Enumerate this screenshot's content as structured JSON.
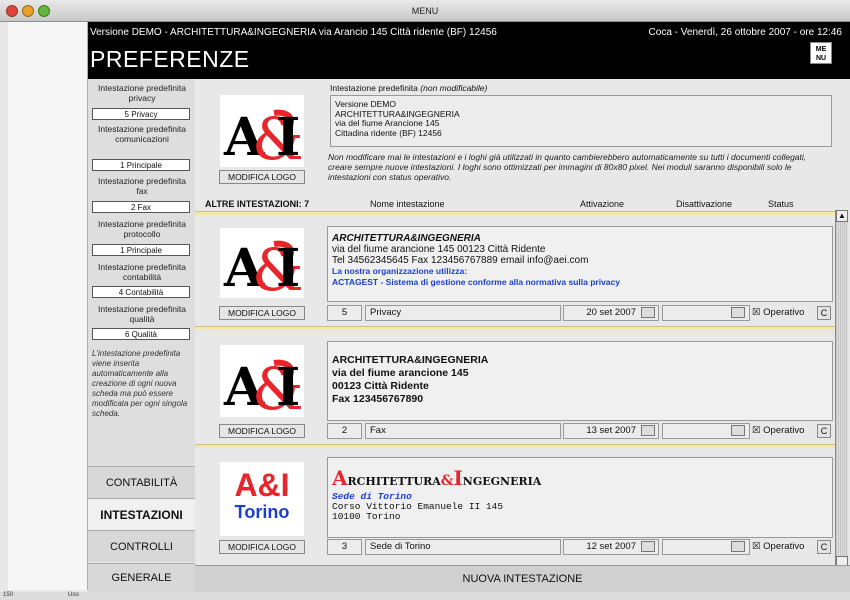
{
  "window": {
    "title": "MENU"
  },
  "header": {
    "demo_line": "Versione DEMO - ARCHITETTURA&INGEGNERIA via Arancio 145 Città ridente (BF) 12456",
    "date_line": "Coca - Venerdì, 26 ottobre 2007 - ore 12:46",
    "page_title": "PREFERENZE",
    "menu_button": "ME NU"
  },
  "prefs": [
    {
      "label": "Intestazione predefinita privacy",
      "value": "5 Privacy"
    },
    {
      "label": "Intestazione predefinita comunicazioni",
      "value": "1 Principale"
    },
    {
      "label": "Intestazione predefinita fax",
      "value": "2 Fax"
    },
    {
      "label": "Intestazione predefinita protocollo",
      "value": "1 Principale"
    },
    {
      "label": "Intestazione predefinita contabilità",
      "value": "4 Contabilità"
    },
    {
      "label": "Intestazione predefinita qualità",
      "value": "6 Qualità"
    }
  ],
  "pref_note": "L'intestazione predefinita viene inserita automaticamente alla creazione di ogni nuova scheda ma può essere modificata per ogni singola scheda.",
  "nav": {
    "contabilita": "CONTABILITÀ",
    "intestazioni": "INTESTAZIONI",
    "controlli": "CONTROLLI",
    "generale": "GENERALE"
  },
  "default_header": {
    "caption": "Intestazione predefinita",
    "caption_note": "(non modificabile)",
    "lines": [
      "Versione DEMO",
      "ARCHITETTURA&INGEGNERIA",
      "via del fiume Arancione 145",
      "Cittadina ridente (BF) 12456"
    ],
    "note": "Non modificare mai le intestazioni e i loghi già utilizzati in quanto cambierebbero automaticamente su tutti i documenti collegati, creare sempre nuove intestazioni. I loghi sono ottimizzati per immagini di 80x80 pixel. Nei moduli saranno disponibili solo le intestazioni con status operativo.",
    "modify_logo": "MODIFICA LOGO",
    "logo_text": "A&I"
  },
  "list": {
    "title": "ALTRE INTESTAZIONI: 7",
    "col_name": "Nome intestazione",
    "col_activation": "Attivazione",
    "col_deactivation": "Disattivazione",
    "col_status": "Status"
  },
  "rows": [
    {
      "modify_logo": "MODIFICA LOGO",
      "logo_text": "A&I",
      "l1": "ARCHITETTURA&INGEGNERIA",
      "l2": "via del fiume arancione 145 00123 Città Ridente",
      "l3": "Tel 34562345645 Fax 123456767889 email info@aei.com",
      "l4": "La nostra organizzazione utilizza:",
      "l5": "ACTAGEST - Sistema di gestione  conforme alla normativa sulla privacy",
      "num": "5",
      "name": "Privacy",
      "activation": "20 set 2007",
      "deactivation": "",
      "status": "Operativo",
      "c": "C"
    },
    {
      "modify_logo": "MODIFICA LOGO",
      "logo_text": "A&I",
      "l1": "ARCHITETTURA&INGEGNERIA",
      "l2": "via del fiume arancione 145",
      "l3": "00123 Città Ridente",
      "l4": "Fax 123456767890",
      "num": "2",
      "name": "Fax",
      "activation": "13 set 2007",
      "deactivation": "",
      "status": "Operativo",
      "c": "C"
    },
    {
      "modify_logo": "MODIFICA LOGO",
      "logo_text": "A&I",
      "logo_sub": "Torino",
      "t_a": "A",
      "t_rch": "RCHITETTURA",
      "t_amp": "&",
      "t_i": "I",
      "t_ng": "NGEGNERIA",
      "l2": "Sede di Torino",
      "l3": "Corso Vittorio Emanuele II 145",
      "l4": "10100 Torino",
      "num": "3",
      "name": "Sede di Torino",
      "activation": "12 set 2007",
      "deactivation": "",
      "status": "Operativo",
      "c": "C"
    }
  ],
  "new_header_button": "NUOVA INTESTAZIONE",
  "statusbar": {
    "zoom": "150",
    "mode": "Uso"
  },
  "colors": {
    "accent_red": "#e8252a",
    "blue_text": "#1a3fd0",
    "header_bg": "#000000"
  }
}
